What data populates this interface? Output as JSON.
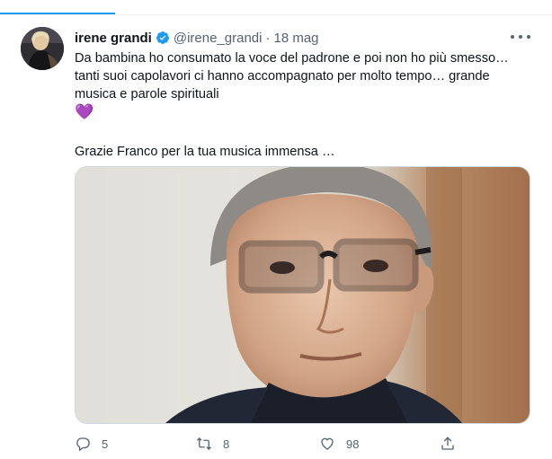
{
  "tweet": {
    "author_name": "irene grandi",
    "handle": "@irene_grandi",
    "separator": "·",
    "date": "18 mag",
    "text_lines": [
      "Da bambina ho consumato la voce del padrone e poi non ho più smesso…",
      "tanti suoi capolavori ci hanno  accompagnato per molto tempo… grande",
      "musica e parole spirituali"
    ],
    "emoji": "💜",
    "second_paragraph": "Grazie Franco per la tua musica immensa …"
  },
  "actions": {
    "reply_count": "5",
    "retweet_count": "8",
    "like_count": "98"
  },
  "icons": {
    "verified": "verified-badge-icon",
    "more": "more-options-icon",
    "reply": "reply-icon",
    "retweet": "retweet-icon",
    "like": "like-icon",
    "share": "share-icon"
  },
  "colors": {
    "accent": "#1d9bf0",
    "secondary_text": "#536471",
    "heart_emoji": "#a78bdf"
  }
}
